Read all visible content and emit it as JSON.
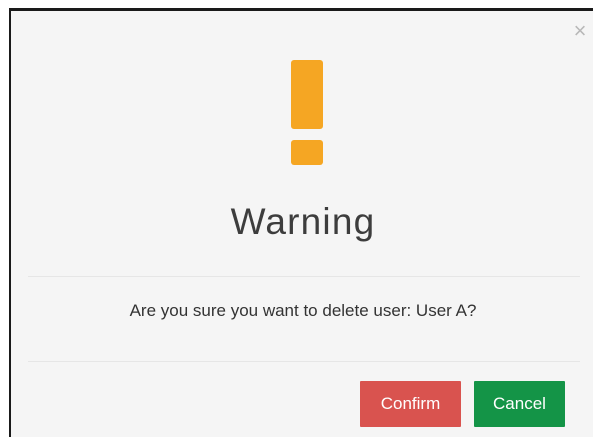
{
  "dialog": {
    "close_glyph": "×",
    "title": "Warning",
    "message": "Are you sure you want to delete user: User A?",
    "icon": "exclamation-icon",
    "buttons": {
      "confirm_label": "Confirm",
      "cancel_label": "Cancel"
    }
  },
  "colors": {
    "warning_icon": "#f5a623",
    "confirm_button": "#d9534f",
    "cancel_button": "#149447",
    "dialog_background": "#f5f5f5"
  }
}
